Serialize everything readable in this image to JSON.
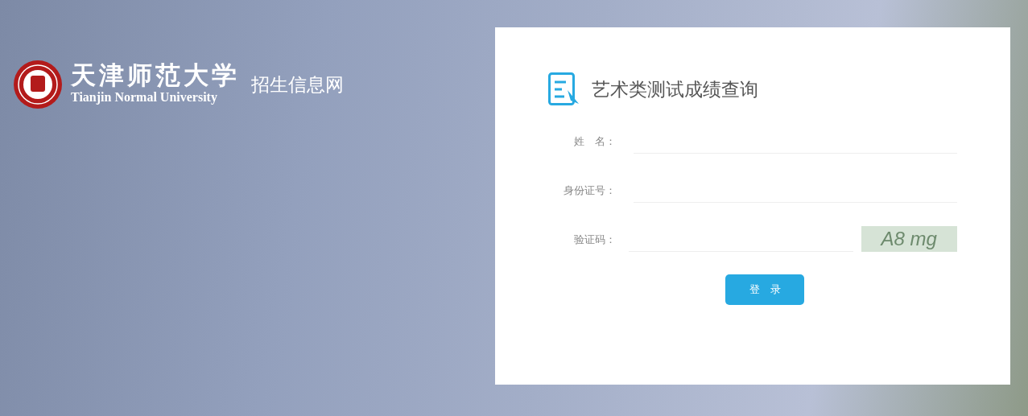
{
  "brand": {
    "name_cn": "天津师范大学",
    "name_en": "Tianjin Normal University",
    "site": "招生信息网"
  },
  "form": {
    "title": "艺术类测试成绩查询",
    "fields": [
      {
        "label": "姓　名：",
        "kind": "text"
      },
      {
        "label": "身份证号：",
        "kind": "text"
      },
      {
        "label": "验证码：",
        "kind": "captcha",
        "captcha": "A8 mg"
      }
    ],
    "submit": "登　录"
  }
}
